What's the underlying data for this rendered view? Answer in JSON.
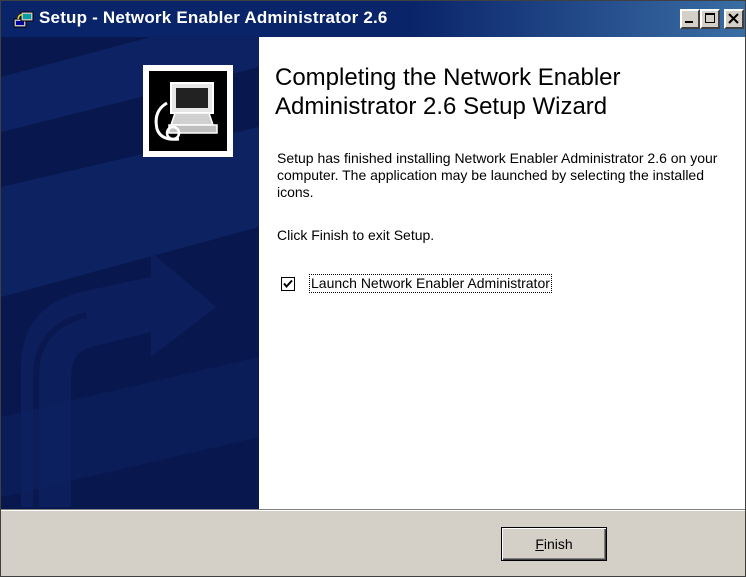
{
  "window": {
    "title": "Setup - Network Enabler Administrator 2.6",
    "title_icon": "setup-computer-icon",
    "controls": {
      "minimize": "minimize-icon",
      "maximize": "maximize-icon",
      "close": "close-icon"
    }
  },
  "sidebar": {
    "logo_icon": "computer-install-icon",
    "background_color": "#08184f"
  },
  "main": {
    "heading": "Completing the Network Enabler Administrator 2.6 Setup Wizard",
    "description": "Setup has finished installing Network Enabler Administrator 2.6 on your computer. The application may be launched by selecting the installed icons.",
    "instruction": "Click Finish to exit Setup.",
    "launch_checkbox": {
      "label": "Launch Network Enabler Administrator",
      "checked": true
    }
  },
  "footer": {
    "finish_button": {
      "accelerator": "F",
      "rest": "inish"
    }
  },
  "colors": {
    "title_bar": "#0a246a",
    "sidebar": "#08184f",
    "dialog_face": "#d4d0c8",
    "content_background": "#ffffff"
  }
}
